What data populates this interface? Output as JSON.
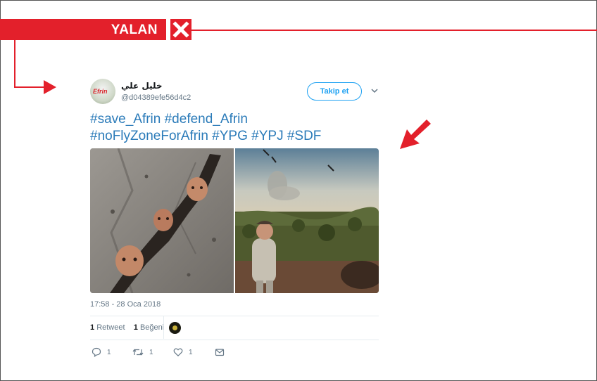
{
  "verdict": {
    "label": "YALAN"
  },
  "tweet": {
    "user_name": "خليل علي",
    "handle": "@d04389efe56d4c2",
    "avatar_text": "Efrin",
    "follow_label": "Takip et",
    "hashtags_line1": "#save_Afrin #defend_Afrin",
    "hashtags_line2": "#noFlyZoneForAfrin #YPG #YPJ #SDF",
    "timestamp": "17:58 - 28 Oca 2018",
    "retweet_count": "1",
    "retweet_label": "Retweet",
    "like_count": "1",
    "like_label": "Beğeni",
    "reply_count": "1",
    "retweet_action_count": "1",
    "like_action_count": "1"
  },
  "icons": [
    "close-icon",
    "chevron-down-icon",
    "reply-icon",
    "retweet-icon",
    "heart-icon",
    "message-icon"
  ],
  "colors": {
    "accent_red": "#e3202b",
    "twitter_blue": "#1da1f2",
    "link_blue": "#2b7bb9",
    "muted": "#657786"
  }
}
